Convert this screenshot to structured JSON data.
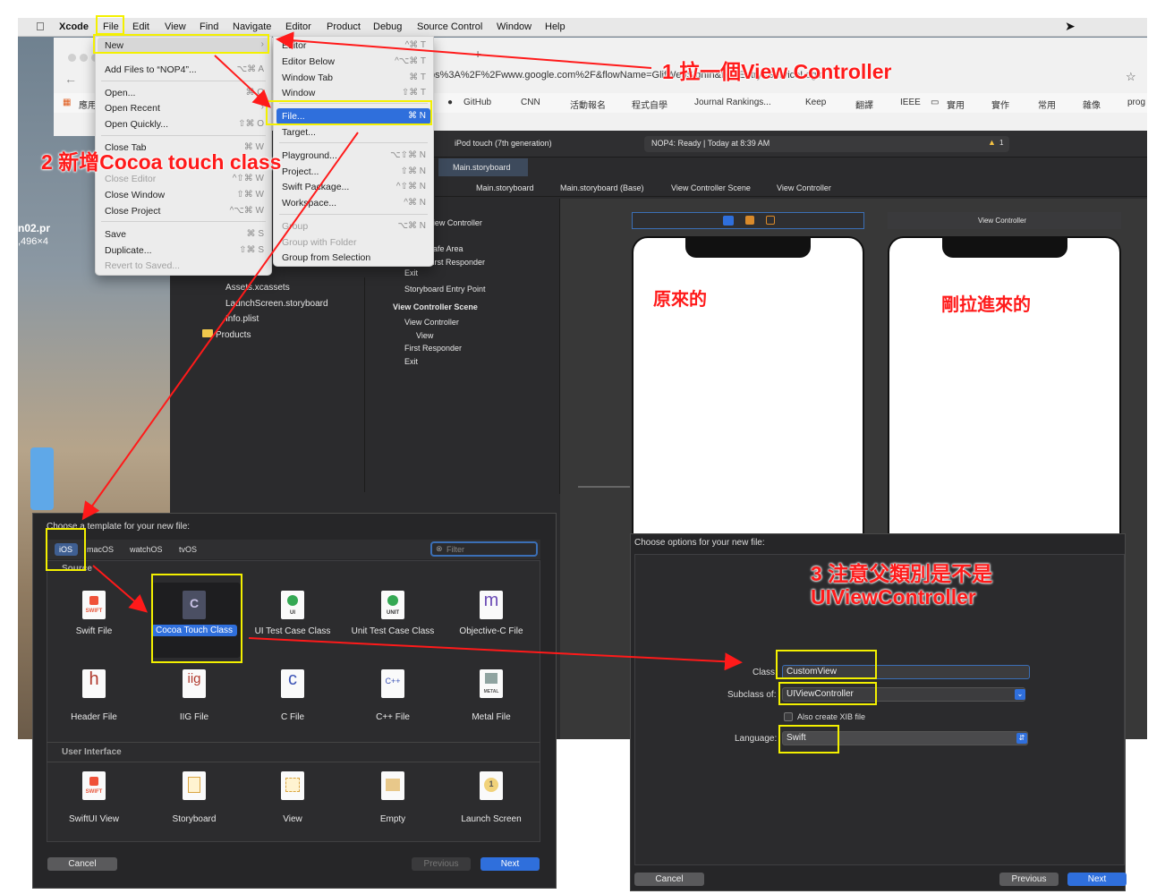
{
  "menubar": {
    "app": "Xcode",
    "items": [
      "File",
      "Edit",
      "View",
      "Find",
      "Navigate",
      "Editor",
      "Product",
      "Debug",
      "Source Control",
      "Window",
      "Help"
    ]
  },
  "file_menu": {
    "items": [
      {
        "label": "New",
        "shortcut": "",
        "highlighted": true
      },
      {
        "label": "Add Files to “NOP4”...",
        "shortcut": "⌥⌘ A"
      },
      {
        "label": "Open...",
        "shortcut": "⌘ O"
      },
      {
        "label": "Open Recent",
        "shortcut": ""
      },
      {
        "label": "Open Quickly...",
        "shortcut": "⇧⌘ O"
      },
      {
        "label": "Close Tab",
        "shortcut": "⌘ W"
      },
      {
        "label": "Close Editor",
        "shortcut": "^⇧⌘ W",
        "disabled": true
      },
      {
        "label": "Close Window",
        "shortcut": "⇧⌘ W"
      },
      {
        "label": "Close Project",
        "shortcut": "^⌥⌘ W"
      },
      {
        "label": "Save",
        "shortcut": "⌘ S"
      },
      {
        "label": "Duplicate...",
        "shortcut": "⇧⌘ S"
      },
      {
        "label": "Revert to Saved...",
        "shortcut": "",
        "disabled": true
      }
    ]
  },
  "new_submenu": {
    "items": [
      {
        "label": "Editor",
        "shortcut": "^⌘ T"
      },
      {
        "label": "Editor Below",
        "shortcut": "^⌥⌘ T"
      },
      {
        "label": "Window Tab",
        "shortcut": "⌘ T"
      },
      {
        "label": "Window",
        "shortcut": "⇧⌘ T"
      },
      {
        "label": "File...",
        "shortcut": "⌘ N",
        "highlighted": true
      },
      {
        "label": "Target...",
        "shortcut": ""
      },
      {
        "label": "Playground...",
        "shortcut": "⌥⇧⌘ N"
      },
      {
        "label": "Project...",
        "shortcut": "⇧⌘ N"
      },
      {
        "label": "Swift Package...",
        "shortcut": "^⇧⌘ N"
      },
      {
        "label": "Workspace...",
        "shortcut": "^⌘ N"
      },
      {
        "label": "Group",
        "shortcut": "⌥⌘ N",
        "disabled": true
      },
      {
        "label": "Group with Folder",
        "shortcut": "",
        "disabled": true
      },
      {
        "label": "Group from Selection",
        "shortcut": ""
      }
    ]
  },
  "browser": {
    "url": "ps%3A%2F%2Fwww.google.com%2F&flowName=GlifWebSignIn&flowEntry=ServiceLogin",
    "bookmarks": [
      "應用",
      "GitHub",
      "CNN",
      "活動報名",
      "程式自學",
      "Journal Rankings...",
      "Keep",
      "翻譯",
      "IEEE",
      "實用",
      "實作",
      "常用",
      "雜像",
      "prog"
    ]
  },
  "xcode": {
    "device": "iPod touch (7th generation)",
    "status": "NOP4: Ready | Today at 8:39 AM",
    "warning_count": "1",
    "active_tab": "Main.storyboard",
    "jump_bar": [
      "NOP4",
      "Main.storyboard",
      "Main.storyboard (Base)",
      "View Controller Scene",
      "View Controller"
    ],
    "project_files": [
      "Assets.xcassets",
      "LaunchScreen.storyboard",
      "Info.plist",
      "Products"
    ],
    "outline": {
      "scene1": {
        "title": "View Controller Scene",
        "items": [
          "View Controller",
          "Safe Area",
          "First Responder",
          "Exit"
        ]
      },
      "entry_point": "Storyboard Entry Point",
      "scene2": {
        "title": "View Controller Scene",
        "items": [
          "View Controller",
          "View",
          "First Responder",
          "Exit"
        ]
      }
    },
    "scene_header_right": "View Controller"
  },
  "template_dialog": {
    "title": "Choose a template for your new file:",
    "platforms": [
      "iOS",
      "macOS",
      "watchOS",
      "tvOS"
    ],
    "filter_placeholder": "Filter",
    "section_source": "Source",
    "source_items": [
      {
        "label": "Swift File",
        "glyph": "SWIFT"
      },
      {
        "label": "Cocoa Touch Class",
        "glyph": "C",
        "selected": true
      },
      {
        "label": "UI Test Case Class",
        "glyph": "UI"
      },
      {
        "label": "Unit Test Case Class",
        "glyph": "UNIT"
      },
      {
        "label": "Objective-C File",
        "glyph": "m"
      },
      {
        "label": "Header File",
        "glyph": "h"
      },
      {
        "label": "IIG File",
        "glyph": "iig"
      },
      {
        "label": "C File",
        "glyph": "c"
      },
      {
        "label": "C++ File",
        "glyph": "C++"
      },
      {
        "label": "Metal File",
        "glyph": "METAL"
      }
    ],
    "section_ui": "User Interface",
    "ui_items": [
      {
        "label": "SwiftUI View",
        "glyph": "SWIFT"
      },
      {
        "label": "Storyboard",
        "glyph": ""
      },
      {
        "label": "View",
        "glyph": ""
      },
      {
        "label": "Empty",
        "glyph": ""
      },
      {
        "label": "Launch Screen",
        "glyph": "1"
      }
    ],
    "cancel": "Cancel",
    "previous": "Previous",
    "next": "Next"
  },
  "options_dialog": {
    "title": "Choose options for your new file:",
    "class_label": "Class:",
    "class_value": "CustomView",
    "subclass_label": "Subclass of:",
    "subclass_value": "UIViewController",
    "xib_label": "Also create XIB file",
    "language_label": "Language:",
    "language_value": "Swift",
    "cancel": "Cancel",
    "previous": "Previous",
    "next": "Next"
  },
  "annotations": {
    "step1": "1 拉一個View Controller",
    "step2": "2 新增Cocoa touch class",
    "step3_line1": "3 注意父類別是不是",
    "step3_line2": "UIViewController",
    "original_label": "原來的",
    "new_label": "剛拉進來的"
  },
  "desktop_text": {
    "filename_fragment": "n02.pr",
    "size_fragment": ",496×4"
  },
  "colors": {
    "highlight_blue": "#2f6fdc",
    "annotation_red": "#ff1a1a",
    "annotation_yellow": "#f3f000",
    "xcode_dark": "#2b2b2d"
  }
}
